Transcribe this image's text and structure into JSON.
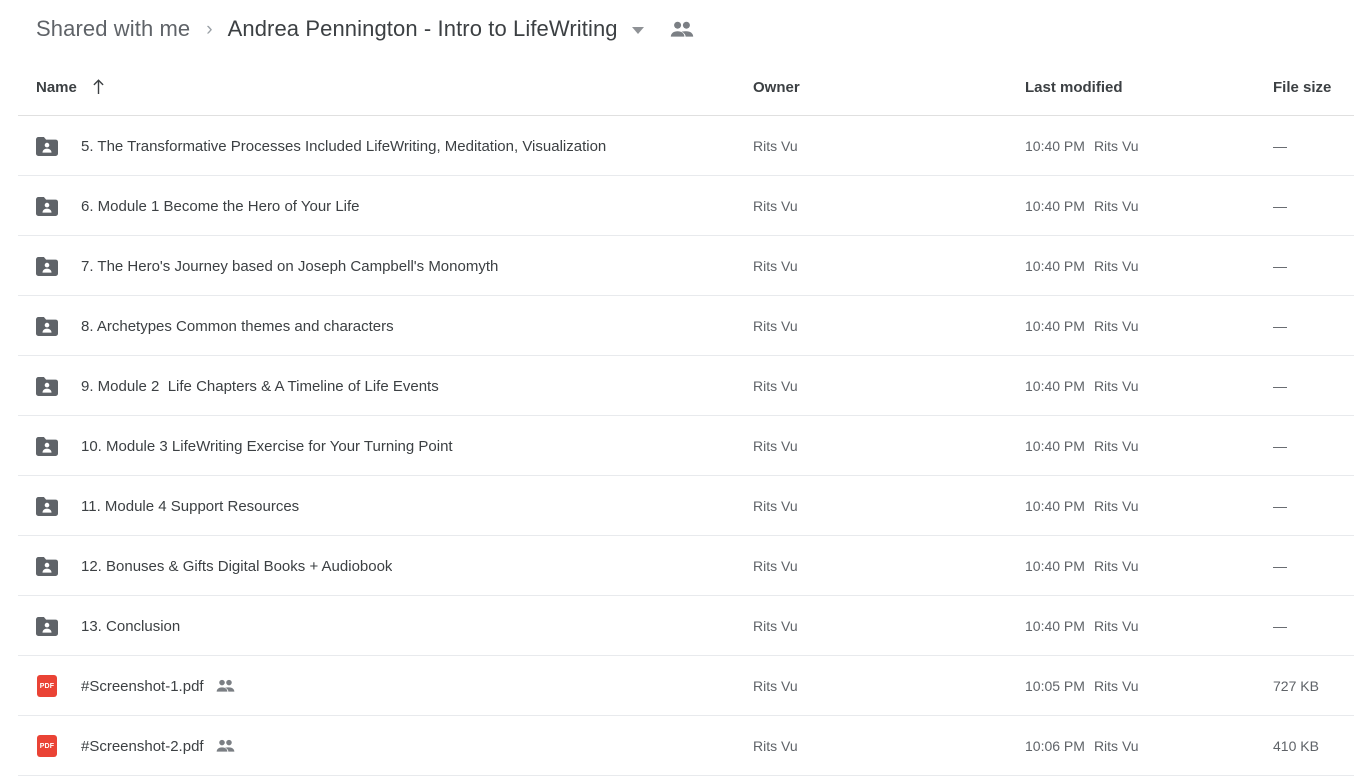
{
  "breadcrumb": {
    "root_label": "Shared with me",
    "separator": "›",
    "current_label": "Andrea Pennington - Intro to LifeWriting",
    "caret_icon": "chevron-down-icon",
    "people_icon": "people-icon"
  },
  "columns": {
    "name": "Name",
    "owner": "Owner",
    "last_modified": "Last modified",
    "file_size": "File size",
    "sort_arrow_icon": "arrow-up-icon",
    "sort_direction": "ascending"
  },
  "colors": {
    "pdf_red": "#ea4335",
    "folder_gray": "#5f6368",
    "text_primary": "#3c4043",
    "text_secondary": "#5f6368",
    "divider": "#e8eaed"
  },
  "rows": [
    {
      "icon": "shared-folder-icon",
      "type": "folder",
      "name": "5. The Transformative Processes Included LifeWriting, Meditation, Visualization",
      "owner": "Rits Vu",
      "modified_time": "10:40 PM",
      "modified_by": "Rits Vu",
      "size": "—",
      "shared_badge": false
    },
    {
      "icon": "shared-folder-icon",
      "type": "folder",
      "name": "6. Module 1 Become the Hero of Your Life",
      "owner": "Rits Vu",
      "modified_time": "10:40 PM",
      "modified_by": "Rits Vu",
      "size": "—",
      "shared_badge": false
    },
    {
      "icon": "shared-folder-icon",
      "type": "folder",
      "name": "7. The Hero's Journey based on Joseph Campbell's Monomyth",
      "owner": "Rits Vu",
      "modified_time": "10:40 PM",
      "modified_by": "Rits Vu",
      "size": "—",
      "shared_badge": false
    },
    {
      "icon": "shared-folder-icon",
      "type": "folder",
      "name": "8. Archetypes Common themes and characters",
      "owner": "Rits Vu",
      "modified_time": "10:40 PM",
      "modified_by": "Rits Vu",
      "size": "—",
      "shared_badge": false
    },
    {
      "icon": "shared-folder-icon",
      "type": "folder",
      "name": "9. Module 2  Life Chapters & A Timeline of Life Events",
      "owner": "Rits Vu",
      "modified_time": "10:40 PM",
      "modified_by": "Rits Vu",
      "size": "—",
      "shared_badge": false
    },
    {
      "icon": "shared-folder-icon",
      "type": "folder",
      "name": "10. Module 3 LifeWriting Exercise for Your Turning Point",
      "owner": "Rits Vu",
      "modified_time": "10:40 PM",
      "modified_by": "Rits Vu",
      "size": "—",
      "shared_badge": false
    },
    {
      "icon": "shared-folder-icon",
      "type": "folder",
      "name": "11. Module 4 Support Resources",
      "owner": "Rits Vu",
      "modified_time": "10:40 PM",
      "modified_by": "Rits Vu",
      "size": "—",
      "shared_badge": false
    },
    {
      "icon": "shared-folder-icon",
      "type": "folder",
      "name": "12. Bonuses & Gifts Digital Books + Audiobook",
      "owner": "Rits Vu",
      "modified_time": "10:40 PM",
      "modified_by": "Rits Vu",
      "size": "—",
      "shared_badge": false
    },
    {
      "icon": "shared-folder-icon",
      "type": "folder",
      "name": "13. Conclusion",
      "owner": "Rits Vu",
      "modified_time": "10:40 PM",
      "modified_by": "Rits Vu",
      "size": "—",
      "shared_badge": false
    },
    {
      "icon": "pdf-file-icon",
      "type": "pdf",
      "icon_label": "PDF",
      "name": "#Screenshot-1.pdf",
      "owner": "Rits Vu",
      "modified_time": "10:05 PM",
      "modified_by": "Rits Vu",
      "size": "727 KB",
      "shared_badge": true
    },
    {
      "icon": "pdf-file-icon",
      "type": "pdf",
      "icon_label": "PDF",
      "name": "#Screenshot-2.pdf",
      "owner": "Rits Vu",
      "modified_time": "10:06 PM",
      "modified_by": "Rits Vu",
      "size": "410 KB",
      "shared_badge": true
    }
  ]
}
